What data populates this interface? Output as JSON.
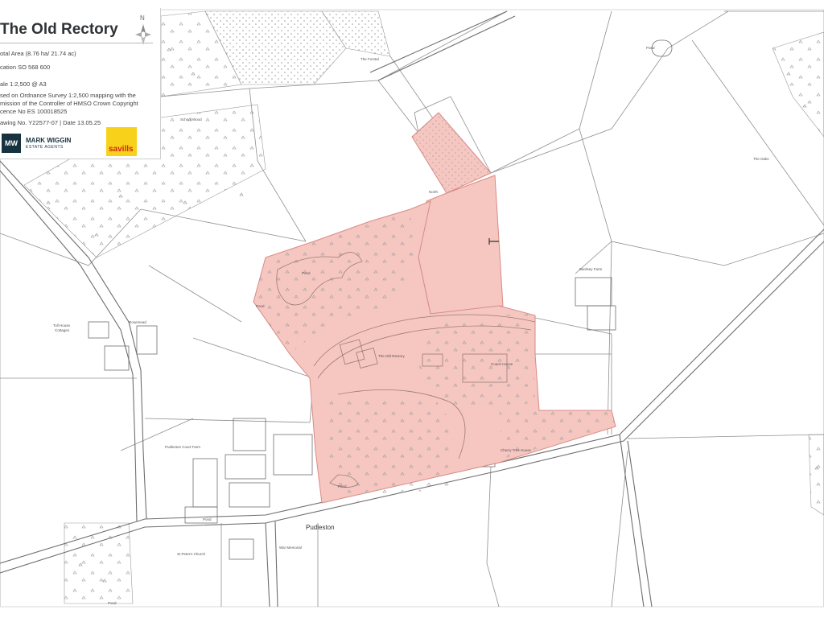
{
  "legend": {
    "title": "The Old Rectory",
    "area": "otal Area (8.76 ha/ 21.74 ac)",
    "location": "cation SO 568 600",
    "scale": "ale 1:2,500 @ A3",
    "os_line1": "sed on Ordnance Survey 1:2,500 mapping with the",
    "os_line2": "mission of the Controller of HMSO   Crown Copyright",
    "os_line3": "cence No ES 100018525",
    "drawing": "awing No. Y22577-07 | Date 13.05.25",
    "north_label": "N",
    "agent": {
      "logo": "MW",
      "name": "MARK WIGGIN",
      "sub": "ESTATE AGENTS"
    },
    "agent2": "savills"
  },
  "labels": {
    "school_wood": "School Wood",
    "the_forstal": "The Forstal",
    "pond_top": "Pond",
    "the_oaks": "The Oaks",
    "pond_lake": "Pond",
    "pond_west": "Pond",
    "bardsey_farm": "Bardsey Farm",
    "rosemead": "Rosemead",
    "toll_house_a": "Toll House",
    "toll_house_b": "Cottages",
    "the_old_rectory": "The Old Rectory",
    "coach_house": "Coach House",
    "pudleston_court_farm": "Pudleston Court Farm",
    "cherry_tree_house": "Cherry Tree House",
    "pond_south": "Pond",
    "pond_village": "Pond",
    "st_peters": "St Peter's Church",
    "pond_bottom": "Pond",
    "north_mark": "North",
    "war_memorial": "War Memorial",
    "pudleston": "Pudleston"
  },
  "colors": {
    "property": "#f6c7c1",
    "property_edge": "#d98a85",
    "lines": "#8a8a8a",
    "road": "#6f6f6f"
  }
}
